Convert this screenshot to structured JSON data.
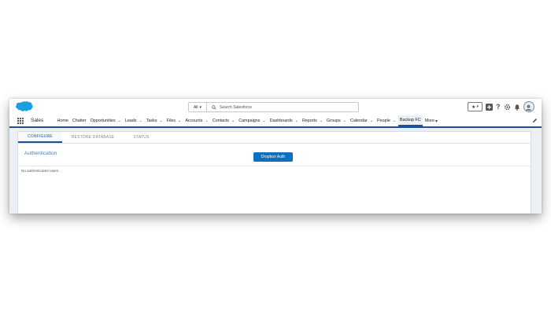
{
  "header": {
    "search_scope": "All",
    "search_placeholder": "Search Salesforce"
  },
  "nav": {
    "app_name": "Sales",
    "items": [
      {
        "label": "Home",
        "has_menu": false
      },
      {
        "label": "Chatter",
        "has_menu": false
      },
      {
        "label": "Opportunities",
        "has_menu": true
      },
      {
        "label": "Leads",
        "has_menu": true
      },
      {
        "label": "Tasks",
        "has_menu": true
      },
      {
        "label": "Files",
        "has_menu": true
      },
      {
        "label": "Accounts",
        "has_menu": true
      },
      {
        "label": "Contacts",
        "has_menu": true
      },
      {
        "label": "Campaigns",
        "has_menu": true
      },
      {
        "label": "Dashboards",
        "has_menu": true
      },
      {
        "label": "Reports",
        "has_menu": true
      },
      {
        "label": "Groups",
        "has_menu": true
      },
      {
        "label": "Calendar",
        "has_menu": true
      },
      {
        "label": "People",
        "has_menu": true
      },
      {
        "label": "Backup FC",
        "has_menu": false,
        "active": true
      },
      {
        "label": "More",
        "has_menu": true
      }
    ]
  },
  "tabs": [
    "CONFIGURE",
    "RESTORE DATABASE",
    "STATUS"
  ],
  "main": {
    "section_title": "Authentication",
    "auth_button": "Dropbox Auth",
    "empty_message": "No authenticated users."
  },
  "colors": {
    "brand_blue": "#1b5297",
    "button_blue": "#0d6fbd",
    "cloud_blue": "#1a9fe0",
    "section_title": "#4e82b5"
  },
  "icons": {
    "logo": "salesforce-cloud",
    "search": "search-icon",
    "favorites": "star-icon",
    "global_add": "plus-icon",
    "help": "question-icon",
    "setup": "gear-icon",
    "notifications": "bell-icon",
    "profile": "avatar",
    "edit_nav": "pencil-icon"
  }
}
